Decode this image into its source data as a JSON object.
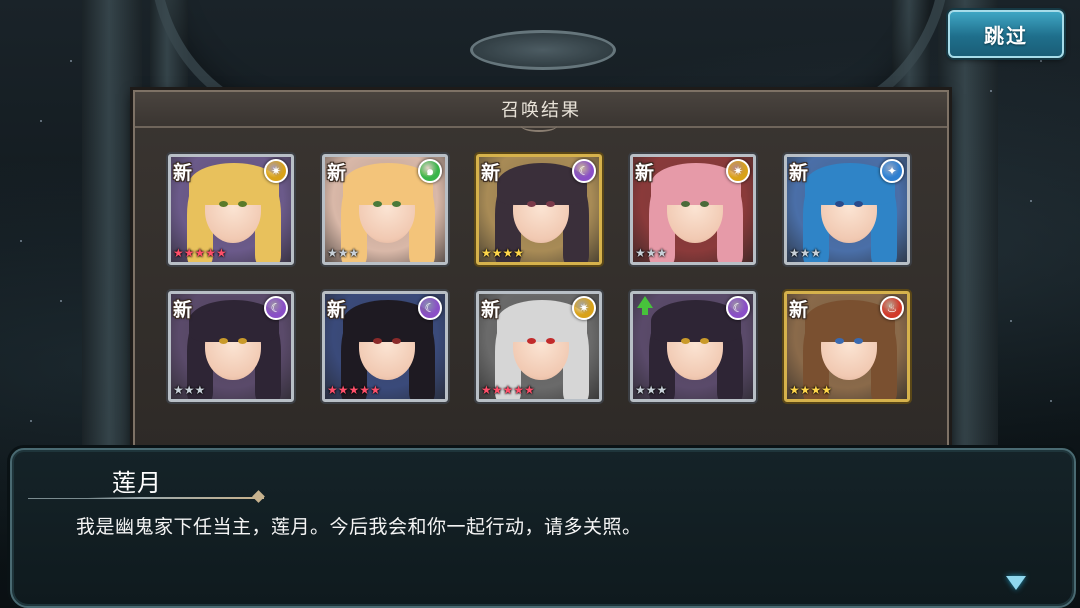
{
  "skip_button": {
    "label": "跳过"
  },
  "panel": {
    "title": "召唤结果"
  },
  "cards": [
    {
      "badge": "新",
      "element_icon": "sun-icon",
      "element_color": "#d9a21a",
      "element_glyph": "✷",
      "stars": "★★★★★",
      "star_color": "#ff4f6a",
      "rarity": 5,
      "hair": "#e8c15c",
      "eye": "#5a7a2a",
      "bg": "#6b5a8a",
      "frame": "silver"
    },
    {
      "badge": "新",
      "element_icon": "wind-icon",
      "element_color": "#39b54a",
      "element_glyph": "๑",
      "stars": "★★★",
      "star_color": "#c8d0d8",
      "rarity": 3,
      "hair": "#f3c47a",
      "eye": "#4a7a3a",
      "bg": "#d9b8a8",
      "frame": "silver"
    },
    {
      "badge": "新",
      "element_icon": "moon-icon",
      "element_color": "#8a4fc7",
      "element_glyph": "☾",
      "stars": "★★★★",
      "star_color": "#ffd64a",
      "rarity": 4,
      "hair": "#3a2f3a",
      "eye": "#7a3a4a",
      "bg": "#a88b56",
      "frame": "gold"
    },
    {
      "badge": "新",
      "element_icon": "sun-icon",
      "element_color": "#d9a21a",
      "element_glyph": "✷",
      "stars": "★★★",
      "star_color": "#c8d0d8",
      "rarity": 3,
      "hair": "#e69aa8",
      "eye": "#4a6a3a",
      "bg": "#8a3a3a",
      "frame": "silver"
    },
    {
      "badge": "新",
      "element_icon": "water-icon",
      "element_color": "#2f7fd0",
      "element_glyph": "✦",
      "stars": "★★★",
      "star_color": "#c8d0d8",
      "rarity": 3,
      "hair": "#2f84c7",
      "eye": "#2a4a8a",
      "bg": "#4a6fa8",
      "frame": "silver"
    },
    {
      "badge": "新",
      "element_icon": "moon-icon",
      "element_color": "#8a4fc7",
      "element_glyph": "☾",
      "stars": "★★★",
      "star_color": "#c8d0d8",
      "rarity": 3,
      "hair": "#2e2535",
      "eye": "#c99a2a",
      "bg": "#5a4a6a",
      "frame": "silver"
    },
    {
      "badge": "新",
      "element_icon": "moon-icon",
      "element_color": "#8a4fc7",
      "element_glyph": "☾",
      "stars": "★★★★★",
      "star_color": "#ff4f6a",
      "rarity": 5,
      "hair": "#1e1a22",
      "eye": "#8a2a2a",
      "bg": "#3a4a7a",
      "frame": "silver"
    },
    {
      "badge": "新",
      "element_icon": "sun-icon",
      "element_color": "#d9a21a",
      "element_glyph": "✷",
      "stars": "★★★★★",
      "star_color": "#ff4f6a",
      "rarity": 5,
      "hair": "#d6d6d6",
      "eye": "#c22a2a",
      "bg": "#6a6a6a",
      "frame": "silver"
    },
    {
      "badge": "",
      "element_icon": "moon-icon",
      "element_color": "#8a4fc7",
      "element_glyph": "☾",
      "stars": "★★★",
      "star_color": "#c8d0d8",
      "rarity": 3,
      "hair": "#2e2535",
      "eye": "#c99a2a",
      "bg": "#5a4a6a",
      "frame": "silver",
      "upgrade": true
    },
    {
      "badge": "新",
      "element_icon": "fire-icon",
      "element_color": "#d23a2a",
      "element_glyph": "♨",
      "stars": "★★★★",
      "star_color": "#ffd64a",
      "rarity": 4,
      "hair": "#7a5030",
      "eye": "#3a6ab0",
      "bg": "#8a6a4a",
      "frame": "gold"
    }
  ],
  "dialog": {
    "speaker": "莲月",
    "text": "我是幽鬼家下任当主，莲月。今后我会和你一起行动，请多关照。"
  }
}
